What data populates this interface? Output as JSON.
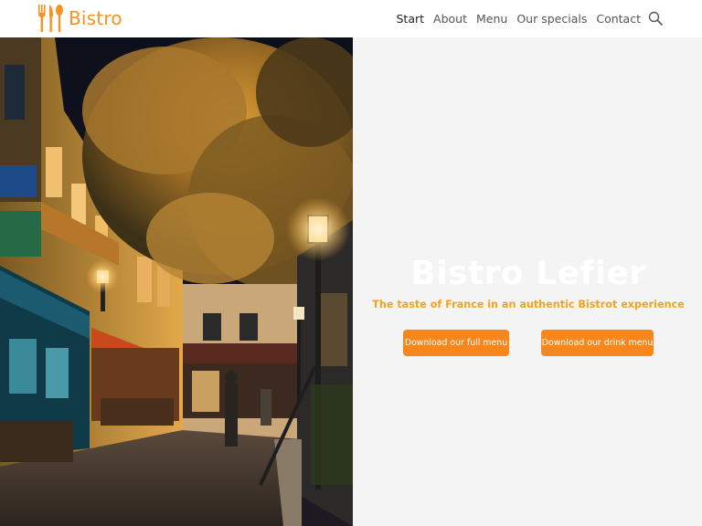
{
  "brand": {
    "name": "Bistro",
    "accent_color": "#f7931e",
    "logo_icon": "fork-knife-spoon-icon"
  },
  "nav": {
    "items": [
      {
        "label": "Start",
        "active": true
      },
      {
        "label": "About",
        "active": false
      },
      {
        "label": "Menu",
        "active": false
      },
      {
        "label": "Our specials",
        "active": false
      },
      {
        "label": "Contact",
        "active": false
      }
    ],
    "search_icon": "search-icon"
  },
  "hero": {
    "image_subject": "night-street-cafe-photo",
    "title": "Bistro Lefier",
    "subtitle": "The taste of France in an authentic Bistrot experience",
    "buttons": {
      "full_menu": "Download our full menu",
      "drink_menu": "Download our drink menu"
    },
    "button_color": "#f7861d",
    "panel_background": "#f4f4f4"
  }
}
